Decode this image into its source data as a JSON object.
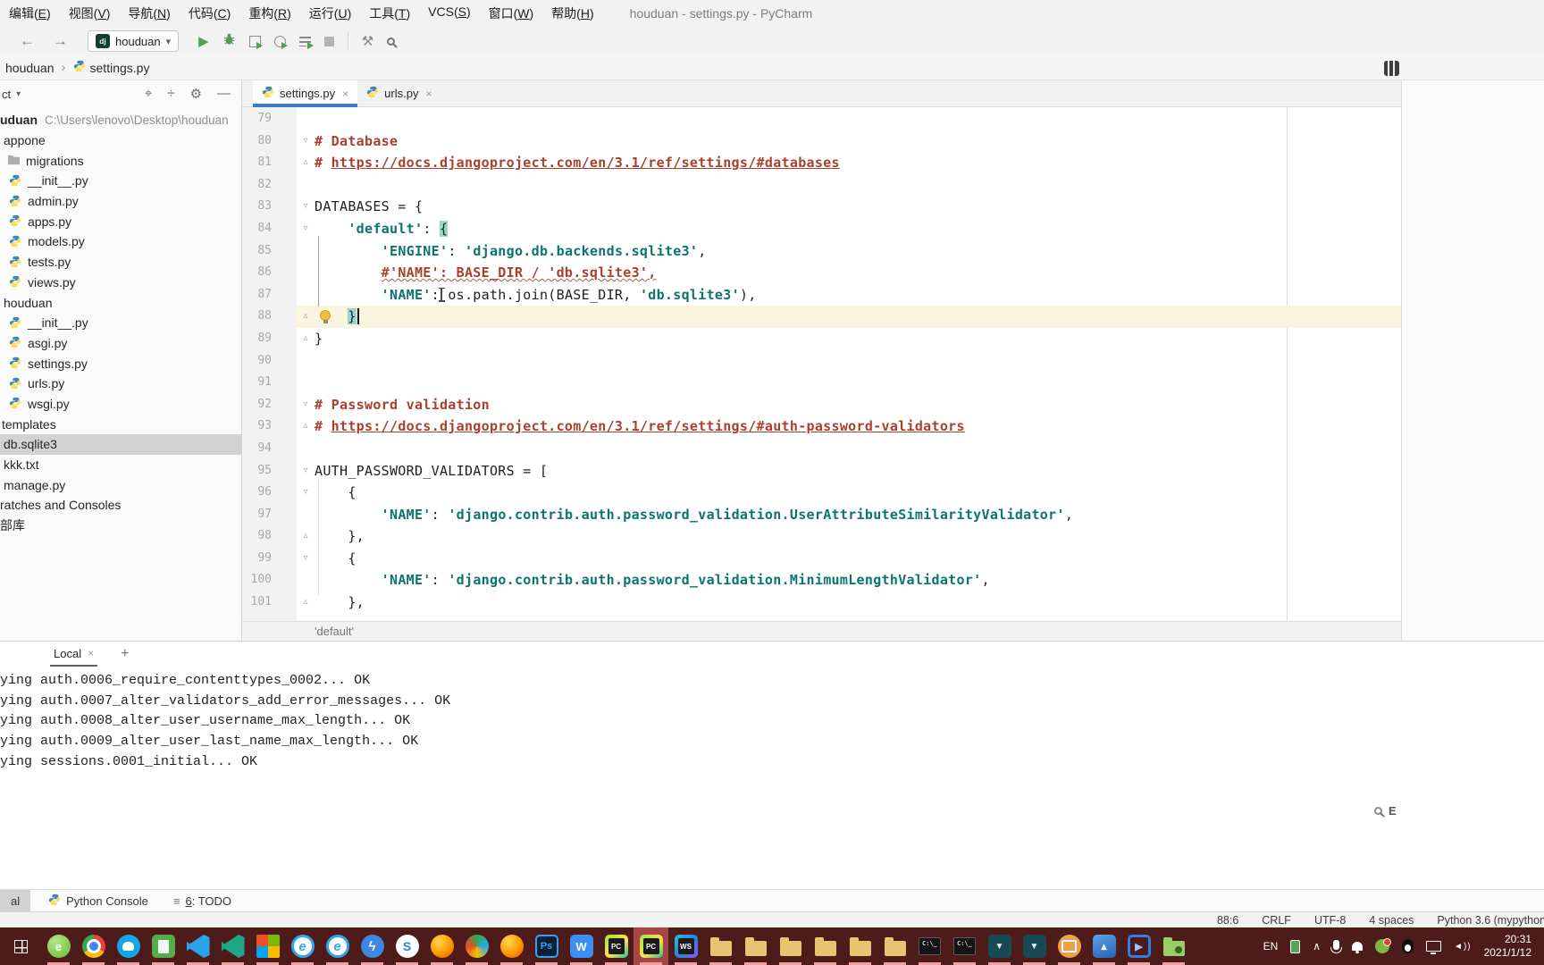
{
  "colors": {
    "accent": "#3c7cbc",
    "string_teal": "#0a756b",
    "comment_red": "#a8402c",
    "active_line": "#faf5df",
    "brace_match": "#97d6c9",
    "taskbar": "#4e1b1b",
    "selection": "#d2d2d2"
  },
  "icons": {
    "back": "←",
    "forward": "→",
    "run": "▶",
    "wrench": "⚒",
    "collapse": "÷",
    "locate": "⌖",
    "settings": "⚙",
    "hide": "—",
    "dropdown": "▾",
    "crumb-sep": "›",
    "close": "×",
    "plus": "+",
    "todo-list": "≡",
    "fold-open": "▿",
    "fold-close": "▵"
  },
  "menubar": {
    "items": [
      {
        "pre": "编辑(",
        "key": "E",
        "post": ")"
      },
      {
        "pre": "视图(",
        "key": "V",
        "post": ")"
      },
      {
        "pre": "导航(",
        "key": "N",
        "post": ")"
      },
      {
        "pre": "代码(",
        "key": "C",
        "post": ")"
      },
      {
        "pre": "重构(",
        "key": "R",
        "post": ")"
      },
      {
        "pre": "运行(",
        "key": "U",
        "post": ")"
      },
      {
        "pre": "工具(",
        "key": "T",
        "post": ")"
      },
      {
        "pre": "VCS(",
        "key": "S",
        "post": ")"
      },
      {
        "pre": "窗口(",
        "key": "W",
        "post": ")"
      },
      {
        "pre": "帮助(",
        "key": "H",
        "post": ")"
      }
    ],
    "title": "houduan - settings.py - PyCharm"
  },
  "toolbar": {
    "run_config": "houduan",
    "dj_label": "dj"
  },
  "breadcrumbs": {
    "project": "houduan",
    "file": "settings.py"
  },
  "project": {
    "header_label": "ct",
    "tree": [
      {
        "indent": 0,
        "label": "uduan",
        "bold": true,
        "path": "C:\\Users\\lenovo\\Desktop\\houduan"
      },
      {
        "indent": 4,
        "label": "appone"
      },
      {
        "indent": 8,
        "icon": "folder",
        "label": "migrations"
      },
      {
        "indent": 10,
        "icon": "python",
        "label": "__init__.py"
      },
      {
        "indent": 10,
        "icon": "python",
        "label": "admin.py"
      },
      {
        "indent": 10,
        "icon": "python",
        "label": "apps.py"
      },
      {
        "indent": 10,
        "icon": "python",
        "label": "models.py"
      },
      {
        "indent": 10,
        "icon": "python",
        "label": "tests.py"
      },
      {
        "indent": 10,
        "icon": "python",
        "label": "views.py"
      },
      {
        "indent": 4,
        "label": "houduan"
      },
      {
        "indent": 10,
        "icon": "python",
        "label": "__init__.py"
      },
      {
        "indent": 10,
        "icon": "python",
        "label": "asgi.py"
      },
      {
        "indent": 10,
        "icon": "python",
        "label": "settings.py"
      },
      {
        "indent": 10,
        "icon": "python",
        "label": "urls.py"
      },
      {
        "indent": 10,
        "icon": "python",
        "label": "wsgi.py"
      },
      {
        "indent": 2,
        "label": "templates"
      },
      {
        "indent": 4,
        "label": "db.sqlite3",
        "selected": true
      },
      {
        "indent": 4,
        "label": "kkk.txt"
      },
      {
        "indent": 4,
        "label": "manage.py"
      },
      {
        "indent": 0,
        "label": "ratches and Consoles"
      },
      {
        "indent": 0,
        "label": "部库"
      }
    ]
  },
  "editor": {
    "tabs": [
      {
        "label": "settings.py",
        "active": true
      },
      {
        "label": "urls.py",
        "active": false
      }
    ],
    "breadcrumb": "'default'",
    "lines": [
      {
        "n": 79,
        "segs": []
      },
      {
        "n": 80,
        "f": "o",
        "segs": [
          [
            "c",
            "# Database"
          ]
        ]
      },
      {
        "n": 81,
        "f": "c",
        "segs": [
          [
            "c",
            "# "
          ],
          [
            "u",
            "https://docs.djangoproject.com/en/3.1/ref/settings/#databases"
          ]
        ]
      },
      {
        "n": 82,
        "segs": []
      },
      {
        "n": 83,
        "f": "o",
        "segs": [
          [
            "p",
            "DATABASES = {"
          ]
        ]
      },
      {
        "n": 84,
        "f": "o",
        "segs": [
          [
            "p",
            "    "
          ],
          [
            "s",
            "'default'"
          ],
          [
            "p",
            ": "
          ],
          [
            "h",
            "{"
          ]
        ]
      },
      {
        "n": 85,
        "segs": [
          [
            "p",
            "        "
          ],
          [
            "s",
            "'ENGINE'"
          ],
          [
            "p",
            ": "
          ],
          [
            "s",
            "'django.db.backends.sqlite3'"
          ],
          [
            "p",
            ","
          ]
        ]
      },
      {
        "n": 86,
        "segs": [
          [
            "p",
            "        "
          ],
          [
            "w",
            "#'NAME': BASE_DIR / 'db.sqlite3',"
          ]
        ]
      },
      {
        "n": 87,
        "ibeam": true,
        "segs": [
          [
            "p",
            "        "
          ],
          [
            "s",
            "'NAME'"
          ],
          [
            "p",
            ": os.path.join(BASE_DIR, "
          ],
          [
            "s",
            "'db.sqlite3'"
          ],
          [
            "p",
            "),"
          ]
        ]
      },
      {
        "n": 88,
        "f": "c",
        "active": true,
        "bulb": true,
        "segs": [
          [
            "p",
            "    "
          ],
          [
            "h",
            "}"
          ],
          [
            "caret",
            ""
          ]
        ]
      },
      {
        "n": 89,
        "f": "c",
        "segs": [
          [
            "p",
            "}"
          ]
        ]
      },
      {
        "n": 90,
        "segs": []
      },
      {
        "n": 91,
        "segs": []
      },
      {
        "n": 92,
        "f": "o",
        "segs": [
          [
            "c",
            "# Password validation"
          ]
        ]
      },
      {
        "n": 93,
        "f": "c",
        "segs": [
          [
            "c",
            "# "
          ],
          [
            "u",
            "https://docs.djangoproject.com/en/3.1/ref/settings/#auth-password-validators"
          ]
        ]
      },
      {
        "n": 94,
        "segs": []
      },
      {
        "n": 95,
        "f": "o",
        "segs": [
          [
            "p",
            "AUTH_PASSWORD_VALIDATORS = ["
          ]
        ]
      },
      {
        "n": 96,
        "f": "o",
        "segs": [
          [
            "p",
            "    {"
          ]
        ]
      },
      {
        "n": 97,
        "segs": [
          [
            "p",
            "        "
          ],
          [
            "s",
            "'NAME'"
          ],
          [
            "p",
            ": "
          ],
          [
            "s",
            "'django.contrib.auth.password_validation.UserAttributeSimilarityValidator'"
          ],
          [
            "p",
            ","
          ]
        ]
      },
      {
        "n": 98,
        "f": "c",
        "segs": [
          [
            "p",
            "    },"
          ]
        ]
      },
      {
        "n": 99,
        "f": "o",
        "segs": [
          [
            "p",
            "    {"
          ]
        ]
      },
      {
        "n": 100,
        "segs": [
          [
            "p",
            "        "
          ],
          [
            "s",
            "'NAME'"
          ],
          [
            "p",
            ": "
          ],
          [
            "s",
            "'django.contrib.auth.password_validation.MinimumLengthValidator'"
          ],
          [
            "p",
            ","
          ]
        ]
      },
      {
        "n": 101,
        "f": "c",
        "segs": [
          [
            "p",
            "    },"
          ]
        ]
      }
    ]
  },
  "console": {
    "tab_label": "Local",
    "event_letter": "E",
    "lines": [
      "ying auth.0006_require_contenttypes_0002... OK",
      "ying auth.0007_alter_validators_add_error_messages... OK",
      "ying auth.0008_alter_user_username_max_length... OK",
      "ying auth.0009_alter_user_last_name_max_length... OK",
      "ying sessions.0001_initial... OK"
    ]
  },
  "toolwindows": {
    "terminal": "al",
    "python_console": "Python Console",
    "todo_number": "6",
    "todo_rest": ": TODO"
  },
  "statusbar": {
    "items": [
      "88:6",
      "CRLF",
      "UTF-8",
      "4 spaces",
      "Python 3.6 (mypython"
    ]
  },
  "taskbar": {
    "items": [
      {
        "name": "browser-360",
        "cls": "i-360g",
        "t": "e",
        "run": true
      },
      {
        "name": "chrome",
        "cls": "i-chrome",
        "run": true
      },
      {
        "name": "qq-browser",
        "cls": "i-qq",
        "run": true
      },
      {
        "name": "notepad",
        "cls": "i-note sq",
        "run": true
      },
      {
        "name": "vscode",
        "cls": "i-vsc",
        "run": true
      },
      {
        "name": "vscode-insiders",
        "cls": "i-vsc i-vsc2",
        "run": true
      },
      {
        "name": "ms-app",
        "cls": "i-ms sq",
        "run": true
      },
      {
        "name": "ie",
        "cls": "i-ie",
        "t": "e",
        "run": true
      },
      {
        "name": "ie-2",
        "cls": "i-ie",
        "t": "e",
        "run": true
      },
      {
        "name": "share-app",
        "cls": "i-bolt",
        "t": "ϟ",
        "run": true
      },
      {
        "name": "safari",
        "cls": "i-saf",
        "t": "S",
        "run": true
      },
      {
        "name": "firefox",
        "cls": "i-ffx",
        "run": true
      },
      {
        "name": "browser-colorful",
        "cls": "i-col",
        "run": true
      },
      {
        "name": "browser-orange",
        "cls": "i-ffx",
        "run": true
      },
      {
        "name": "photoshop",
        "cls": "i-ps sq",
        "t": "Ps",
        "run": true
      },
      {
        "name": "wps",
        "cls": "i-wps sq",
        "t": "W",
        "run": true
      },
      {
        "name": "pycharm",
        "cls": "i-pyc sq",
        "run": true
      },
      {
        "name": "pycharm-active",
        "cls": "i-pyc sq",
        "run": true,
        "active": true
      },
      {
        "name": "webstorm",
        "cls": "i-pyc i-ws sq",
        "run": true
      },
      {
        "name": "folder-1",
        "cls": "i-fold",
        "run": true
      },
      {
        "name": "folder-2",
        "cls": "i-fold",
        "run": true
      },
      {
        "name": "folder-3",
        "cls": "i-fold",
        "run": true
      },
      {
        "name": "folder-4",
        "cls": "i-fold",
        "run": true
      },
      {
        "name": "folder-5",
        "cls": "i-fold",
        "run": true
      },
      {
        "name": "folder-6",
        "cls": "i-fold",
        "run": true
      },
      {
        "name": "cmd-1",
        "cls": "i-cmd sq",
        "t": "C:\\_",
        "run": true
      },
      {
        "name": "cmd-2",
        "cls": "i-cmd sq",
        "t": "C:\\_",
        "run": true
      },
      {
        "name": "hbuilder-1",
        "cls": "i-hb sq",
        "t": "▼",
        "run": true
      },
      {
        "name": "hbuilder-2",
        "cls": "i-hb sq",
        "t": "▼",
        "run": true
      },
      {
        "name": "app-orange",
        "cls": "i-case",
        "run": true
      },
      {
        "name": "photos",
        "cls": "i-photos sq",
        "t": "▴",
        "run": true
      },
      {
        "name": "video-player",
        "cls": "i-player sq",
        "t": "▶",
        "run": true
      },
      {
        "name": "media-folder",
        "cls": "i-mfold",
        "run": true
      }
    ],
    "tray": {
      "lang": "EN",
      "icons": [
        "usb",
        "chevron-up",
        "mic",
        "bell",
        "safe-360",
        "qq",
        "monitor",
        "speaker"
      ],
      "time": "20:31",
      "date": "2021/1/12"
    }
  }
}
